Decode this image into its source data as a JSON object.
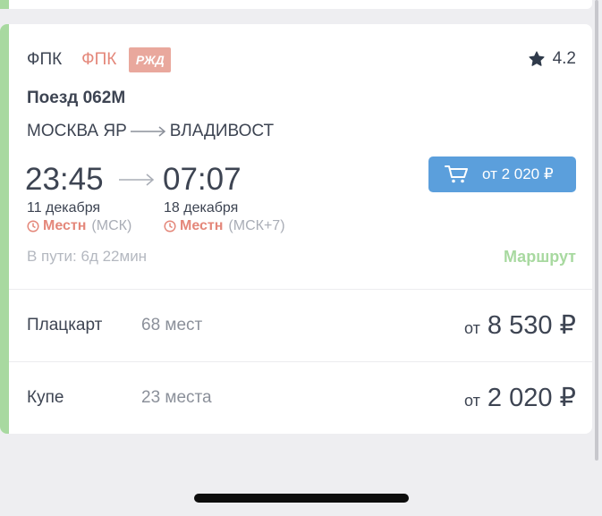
{
  "carrier": {
    "name1": "ФПК",
    "name2": "ФПК",
    "logo_text": "РЖД"
  },
  "rating": {
    "value": "4.2",
    "icon": "star-icon"
  },
  "train": {
    "name": "Поезд 062М",
    "from": "МОСКВА ЯР",
    "to": "ВЛАДИВОСТ"
  },
  "departure": {
    "time": "23:45",
    "date": "11 декабря",
    "tz_label": "Местн",
    "tz_zone": "(МСК)"
  },
  "arrival": {
    "time": "07:07",
    "date": "18 декабря",
    "tz_label": "Местн",
    "tz_zone": "(МСК+7)"
  },
  "duration": "В пути: 6д 22мин",
  "route_link": "Маршрут",
  "buy_button": {
    "label": "от 2 020 ₽",
    "icon": "cart-icon"
  },
  "classes": [
    {
      "type": "Плацкарт",
      "seats": "68 мест",
      "price_prefix": "от",
      "price": "8 530 ₽"
    },
    {
      "type": "Купе",
      "seats": "23 места",
      "price_prefix": "от",
      "price": "2 020 ₽"
    }
  ],
  "colors": {
    "accent_green": "#a8d9a0",
    "button_blue": "#5b9fdc",
    "carrier_red": "#e4877a"
  }
}
